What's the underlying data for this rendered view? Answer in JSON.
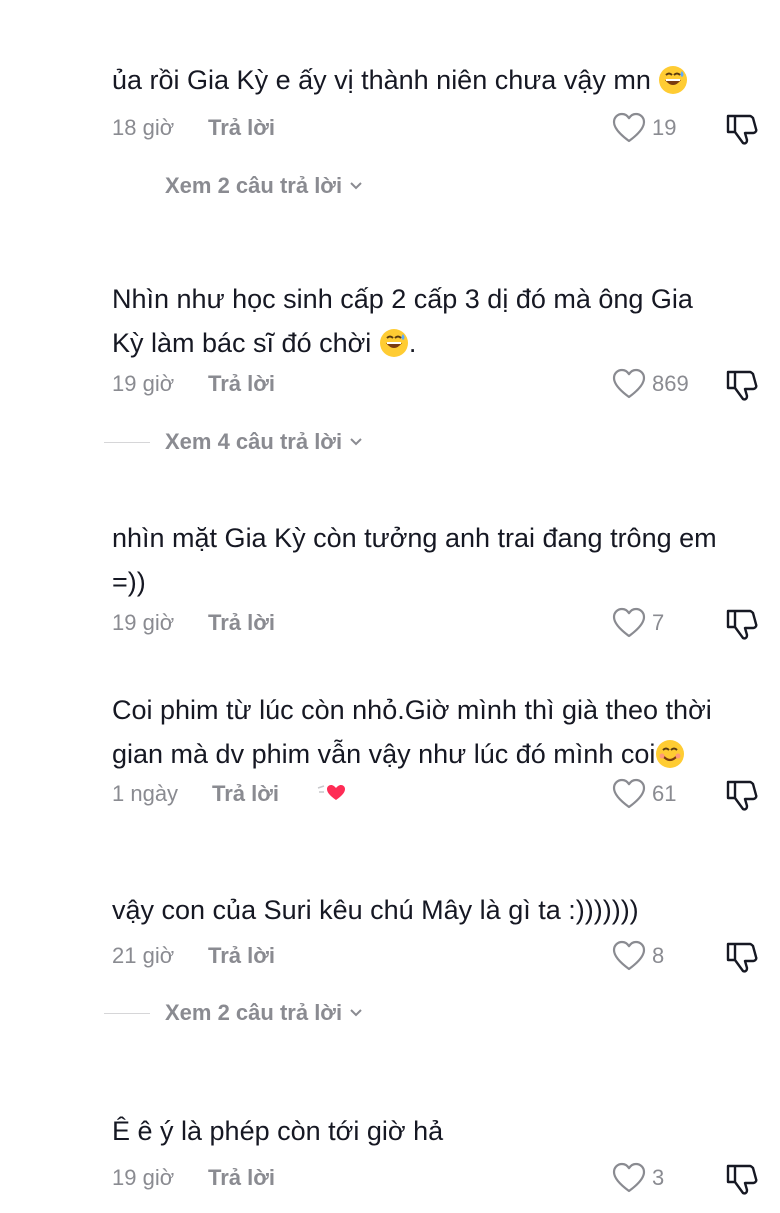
{
  "comments": [
    {
      "text": "ủa rồi Gia Kỳ e ấy vị thành niên chưa vậy mn",
      "time": "18 giờ",
      "reply": "Trả lời",
      "likes": "19",
      "view_replies": "Xem 2 câu trả lời"
    },
    {
      "line1": "Nhìn như học sinh cấp 2 cấp 3 dị đó mà ông Gia",
      "line2": "Kỳ làm bác sĩ đó chời",
      "line2_tail": ".",
      "time": "19 giờ",
      "reply": "Trả lời",
      "likes": "869",
      "view_replies": "Xem 4 câu trả lời"
    },
    {
      "line1": "nhìn mặt Gia Kỳ còn tưởng anh trai đang trông em",
      "line2": "=))",
      "time": "19 giờ",
      "reply": "Trả lời",
      "likes": "7"
    },
    {
      "line1": "Coi phim từ lúc còn nhỏ.Giờ mình thì già theo thời",
      "line2": "gian mà dv phim vẫn vậy như lúc đó mình coi",
      "time": "1 ngày",
      "reply": "Trả lời",
      "likes": "61"
    },
    {
      "text": "vậy con của Suri kêu chú Mây là gì ta :)))))))",
      "time": "21 giờ",
      "reply": "Trả lời",
      "likes": "8",
      "view_replies": "Xem 2 câu trả lời"
    },
    {
      "text": "Ê ê ý là phép còn tới giờ hả",
      "time": "19 giờ",
      "reply": "Trả lời",
      "likes": "3"
    }
  ],
  "icons": {
    "like": "heart-outline-icon",
    "dislike": "thumbs-down-icon",
    "expand": "chevron-down-icon",
    "creator_liked": "creator-liked-heart-icon",
    "emoji": "grinning-sweat-emoji"
  },
  "colors": {
    "text": "#161823",
    "secondary": "#8a8b91",
    "creator_heart": "#fe2c55"
  }
}
